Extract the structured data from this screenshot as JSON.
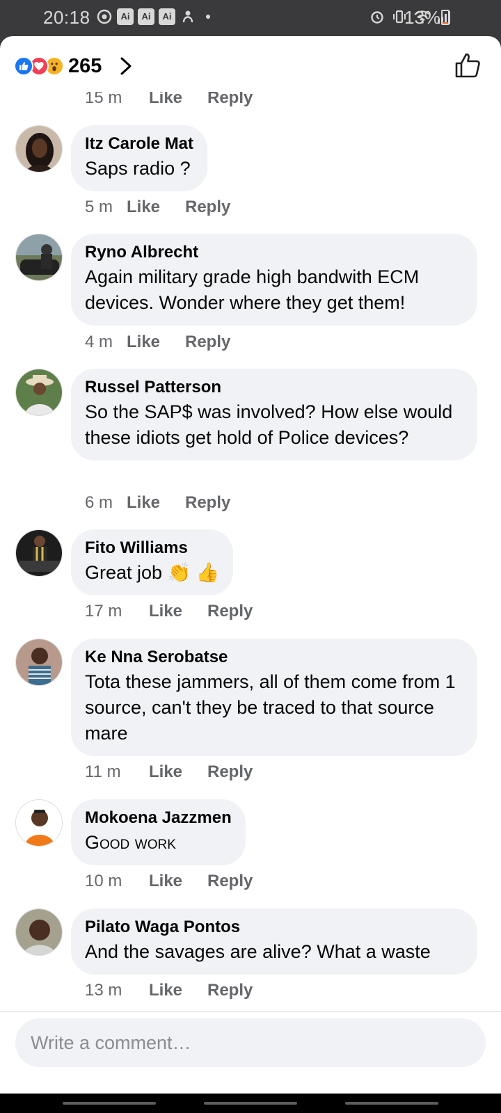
{
  "status_bar": {
    "time": "20:18",
    "left_icons": [
      "whatsapp-icon",
      "ai-icon",
      "ai-icon",
      "ai-icon",
      "fingerprint-icon"
    ],
    "ai_label": "Ai",
    "right_icons": [
      "alarm-icon",
      "vibrate-icon",
      "wifi-icon",
      "signal-icon"
    ],
    "battery": "13%",
    "battery_level": 0.13
  },
  "header": {
    "reactions": [
      "like",
      "love",
      "wow"
    ],
    "reaction_count": "265"
  },
  "top_meta": {
    "time": "15 m",
    "like": "Like",
    "reply": "Reply"
  },
  "comments": [
    {
      "author": "Itz Carole Mat",
      "text": "Saps radio ?",
      "time": "5 m",
      "like": "Like",
      "reply": "Reply"
    },
    {
      "author": "Ryno Albrecht",
      "text": "Again military grade high bandwith ECM devices. Wonder where they get them!",
      "time": "4 m",
      "like": "Like",
      "reply": "Reply"
    },
    {
      "author": "Russel Patterson",
      "text": "So the SAP$ was involved? How else would these idiots get hold of Police devices?",
      "time": "6 m",
      "like": "Like",
      "reply": "Reply"
    },
    {
      "author": "Fito Williams",
      "text": "Great job 👏 👍",
      "time": "17 m",
      "like": "Like",
      "reply": "Reply"
    },
    {
      "author": "Ke Nna Serobatse",
      "text": "Tota these jammers, all of them come from 1 source, can't they be traced to that source mare",
      "time": "11 m",
      "like": "Like",
      "reply": "Reply"
    },
    {
      "author": "Mokoena Jazzmen",
      "text": "Good work",
      "time": "10 m",
      "like": "Like",
      "reply": "Reply"
    },
    {
      "author": "Pilato Waga Pontos",
      "text": "And the savages are alive? What a waste",
      "time": "13 m",
      "like": "Like",
      "reply": "Reply"
    }
  ],
  "composer": {
    "placeholder": "Write a comment…"
  }
}
